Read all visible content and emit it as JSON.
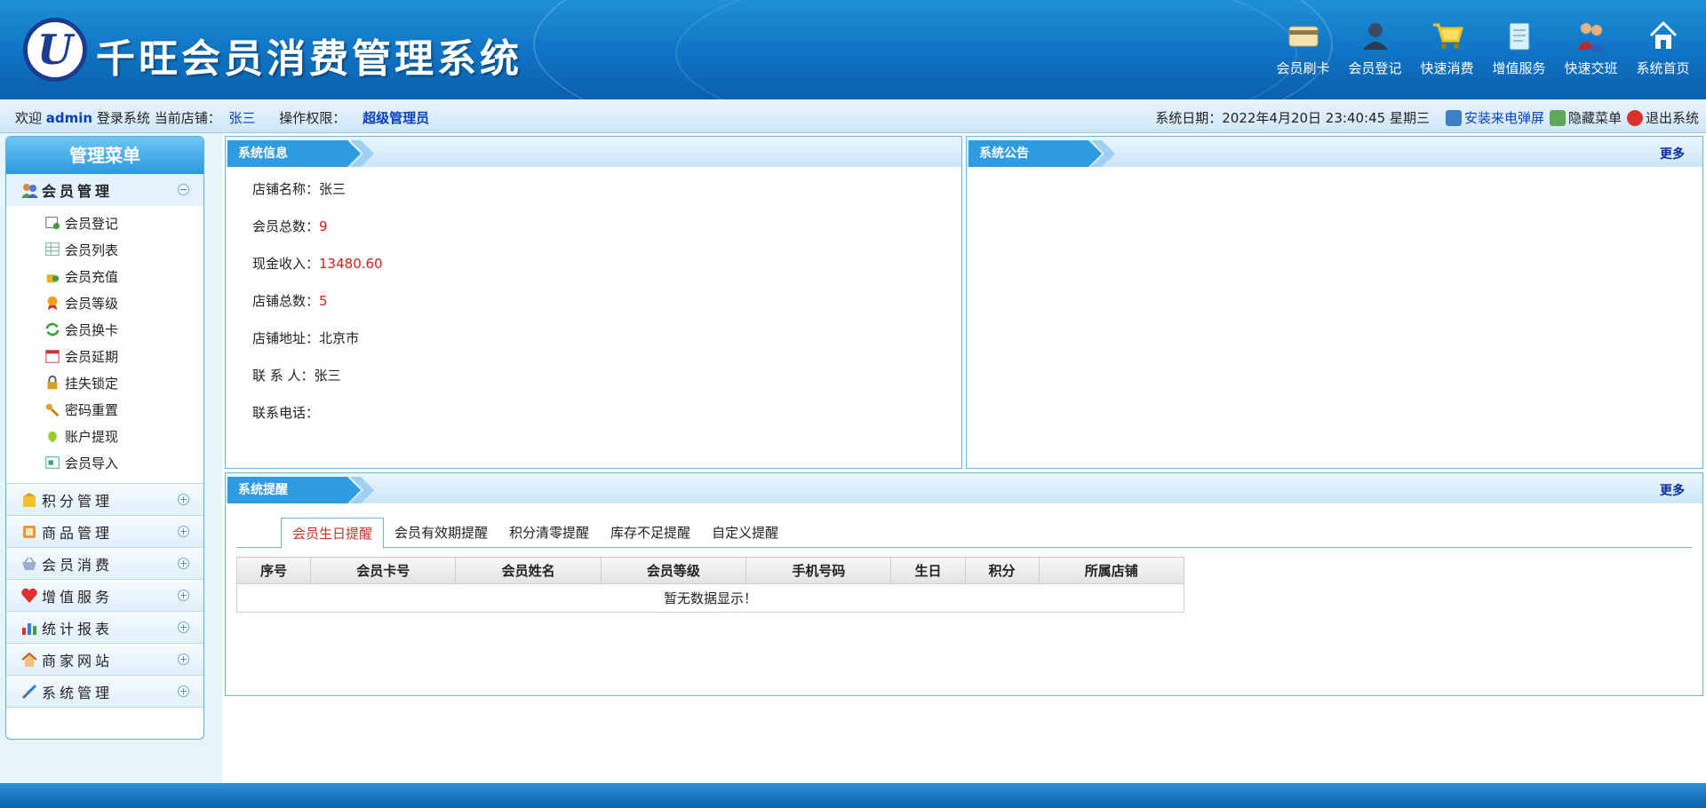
{
  "header": {
    "logo_letter": "U",
    "title": "千旺会员消费管理系统",
    "nav": [
      {
        "label": "会员刷卡",
        "icon": "card-icon"
      },
      {
        "label": "会员登记",
        "icon": "user-register-icon"
      },
      {
        "label": "快速消费",
        "icon": "cart-icon"
      },
      {
        "label": "增值服务",
        "icon": "clipboard-icon"
      },
      {
        "label": "快速交班",
        "icon": "handover-icon"
      },
      {
        "label": "系统首页",
        "icon": "home-icon"
      }
    ]
  },
  "infobar": {
    "welcome": "欢迎",
    "username": "admin",
    "login_text": "登录系统",
    "store_label": "当前店铺：",
    "store_name": "张三",
    "perm_label": "操作权限：",
    "perm_value": "超级管理员",
    "date_label": "系统日期：",
    "date_value": "2022年4月20日 23:40:45 星期三",
    "install_popup": "安装来电弹屏",
    "hide_menu": "隐藏菜单",
    "logout": "退出系统"
  },
  "sidebar": {
    "title": "管理菜单",
    "groups": [
      {
        "label": "会员管理",
        "icon": "members-icon",
        "toggle": "−",
        "items": [
          {
            "label": "会员登记",
            "icon": "register-icon"
          },
          {
            "label": "会员列表",
            "icon": "list-icon"
          },
          {
            "label": "会员充值",
            "icon": "recharge-icon"
          },
          {
            "label": "会员等级",
            "icon": "medal-icon"
          },
          {
            "label": "会员换卡",
            "icon": "swap-icon"
          },
          {
            "label": "会员延期",
            "icon": "calendar-icon"
          },
          {
            "label": "挂失锁定",
            "icon": "lock-icon"
          },
          {
            "label": "密码重置",
            "icon": "key-icon"
          },
          {
            "label": "账户提现",
            "icon": "money-bag-icon"
          },
          {
            "label": "会员导入",
            "icon": "import-icon"
          }
        ]
      },
      {
        "label": "积分管理",
        "icon": "points-icon",
        "toggle": "+"
      },
      {
        "label": "商品管理",
        "icon": "goods-icon",
        "toggle": "+"
      },
      {
        "label": "会员消费",
        "icon": "basket-icon",
        "toggle": "+"
      },
      {
        "label": "增值服务",
        "icon": "heart-icon",
        "toggle": "+"
      },
      {
        "label": "统计报表",
        "icon": "bar-chart-icon",
        "toggle": "+"
      },
      {
        "label": "商家网站",
        "icon": "house-icon",
        "toggle": "+"
      },
      {
        "label": "系统管理",
        "icon": "tools-icon",
        "toggle": "+"
      }
    ]
  },
  "sysinfo": {
    "title": "系统信息",
    "rows": [
      {
        "label": "店铺名称：",
        "value": "张三",
        "red": false
      },
      {
        "label": "会员总数：",
        "value": "9",
        "red": true
      },
      {
        "label": "现金收入：",
        "value": "13480.60",
        "red": true
      },
      {
        "label": "店铺总数：",
        "value": "5",
        "red": true
      },
      {
        "label": "店铺地址：",
        "value": "北京市",
        "red": false
      },
      {
        "label": "联 系 人：",
        "value": "张三",
        "red": false
      },
      {
        "label": "联系电话：",
        "value": "",
        "red": false
      }
    ]
  },
  "notice": {
    "title": "系统公告",
    "more": "更多"
  },
  "reminder": {
    "title": "系统提醒",
    "more": "更多",
    "tabs": [
      "会员生日提醒",
      "会员有效期提醒",
      "积分清零提醒",
      "库存不足提醒",
      "自定义提醒"
    ],
    "active_tab": 0,
    "columns": [
      "序号",
      "会员卡号",
      "会员姓名",
      "会员等级",
      "手机号码",
      "生日",
      "积分",
      "所属店铺"
    ],
    "empty_text": "暂无数据显示！"
  }
}
